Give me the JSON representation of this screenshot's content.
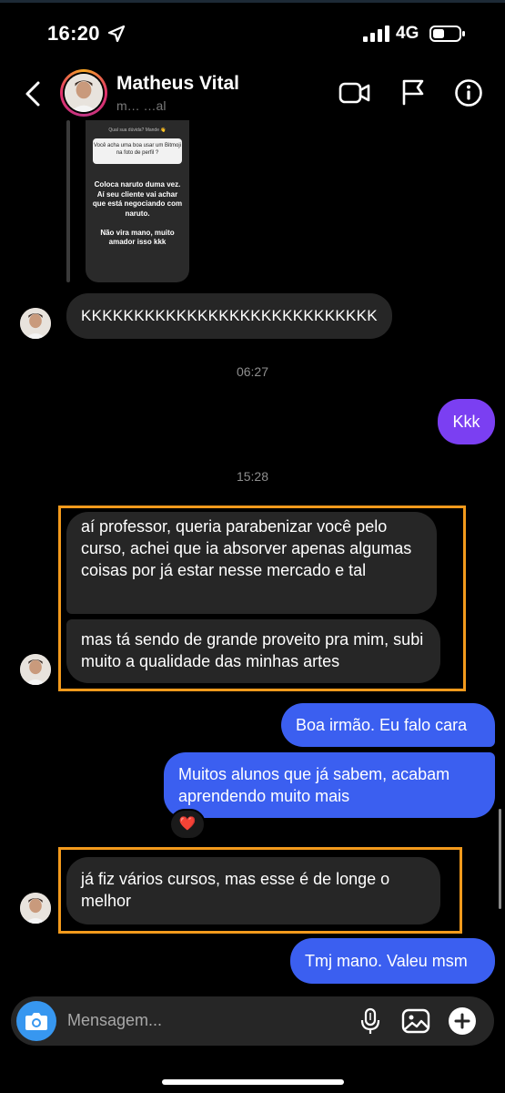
{
  "status_bar": {
    "time": "16:20",
    "network": "4G"
  },
  "header": {
    "name": "Matheus Vital",
    "username": "m… …al"
  },
  "story": {
    "question_head": "Qual sua dúvida? Mande 👋",
    "question": "Você acha uma boa usar um Bitmoji na foto de perfil ?",
    "answer": "Coloca naruto duma vez. Aí seu cliente vai achar que está negociando com naruto.\n\nNão vira mano, muito amador isso kkk"
  },
  "messages": [
    {
      "id": "m1",
      "text": "KKKKKKKKKKKKKKKKKKKKKKKKKKKK"
    },
    {
      "id": "ts1",
      "text": "06:27"
    },
    {
      "id": "m2",
      "text": "Kkk"
    },
    {
      "id": "ts2",
      "text": "15:28"
    },
    {
      "id": "m3",
      "text": "aí professor, queria parabenizar você pelo curso, achei que ia absorver apenas algumas coisas por já estar nesse mercado e tal"
    },
    {
      "id": "m4",
      "text": "mas tá sendo de grande proveito pra mim, subi muito a qualidade das minhas artes"
    },
    {
      "id": "m5",
      "text": "Boa irmão. Eu falo cara"
    },
    {
      "id": "m6",
      "text": "Muitos alunos que já sabem, acabam aprendendo muito mais"
    },
    {
      "id": "m7",
      "text": "já fiz vários cursos, mas esse é de longe o melhor"
    },
    {
      "id": "m8",
      "text": "Tmj mano. Valeu msm"
    }
  ],
  "reaction": "❤️",
  "composer": {
    "placeholder": "Mensagem..."
  },
  "colors": {
    "highlight": "#f39a1c",
    "outgoing": "#3b5ff0",
    "outgoing_alt": "#7b3ff2",
    "incoming": "#262626",
    "camera": "#3797f0"
  },
  "icons": [
    "location-arrow-icon",
    "signal-icon",
    "battery-icon",
    "back-icon",
    "video-call-icon",
    "flag-icon",
    "info-icon",
    "camera-icon",
    "mic-icon",
    "gallery-icon",
    "plus-icon"
  ]
}
